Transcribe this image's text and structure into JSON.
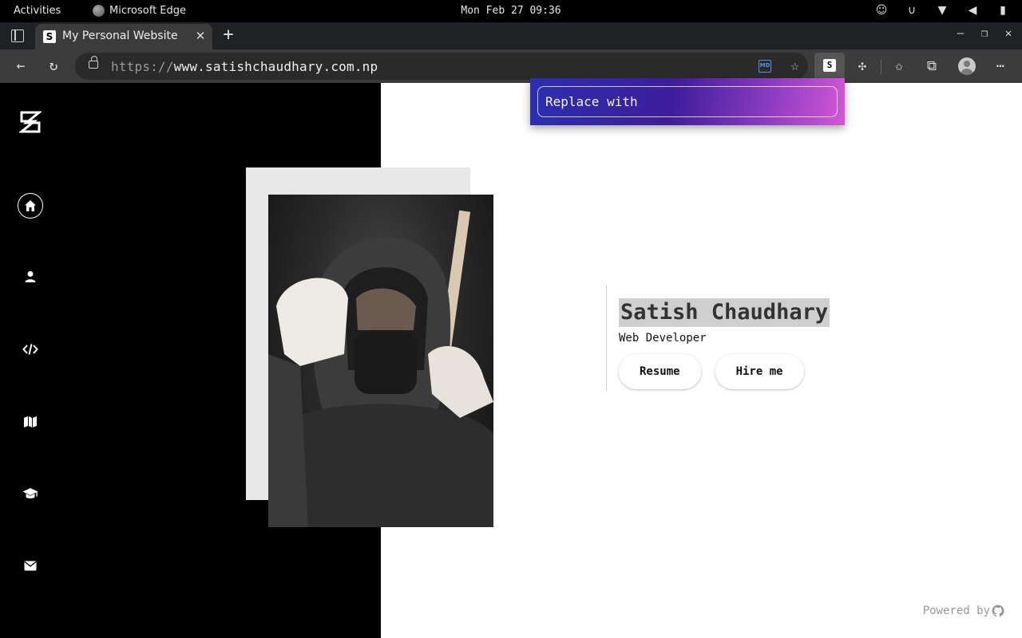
{
  "system": {
    "activities": "Activities",
    "app_name": "Microsoft Edge",
    "clock": "Mon Feb 27 09:36"
  },
  "browser": {
    "tab_title": "My Personal Website",
    "url_scheme": "https://",
    "url_host": "www.satishchaudhary.com.np",
    "md_icon_label": "MD"
  },
  "extension_popup": {
    "placeholder": "Replace with"
  },
  "page": {
    "name": "Satish Chaudhary",
    "role": "Web Developer",
    "buttons": {
      "resume": "Resume",
      "hire": "Hire me"
    },
    "footer": "Powered by"
  },
  "colors": {
    "accent_gradient_start": "#2b2fb0",
    "accent_gradient_end": "#d457d6",
    "sidebar_bg": "#000000",
    "name_highlight": "#cfcfcf"
  },
  "icons": {
    "nav": [
      "home-icon",
      "user-icon",
      "code-icon",
      "map-icon",
      "graduation-cap-icon",
      "envelope-icon"
    ]
  }
}
